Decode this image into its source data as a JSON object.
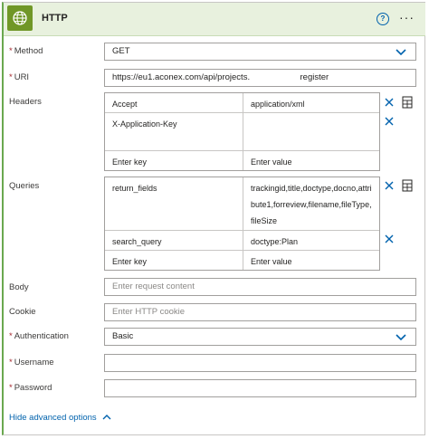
{
  "header": {
    "title": "HTTP",
    "help_glyph": "?",
    "more_glyph": "···"
  },
  "method": {
    "label": "Method",
    "value": "GET"
  },
  "uri": {
    "label": "URI",
    "value": "https://eu1.aconex.com/api/projects.                     register"
  },
  "headers": {
    "label": "Headers",
    "rows": [
      {
        "key": "Accept",
        "value": "application/xml"
      },
      {
        "key": "X-Application-Key",
        "value": ""
      }
    ],
    "key_placeholder": "Enter key",
    "value_placeholder": "Enter value"
  },
  "queries": {
    "label": "Queries",
    "rows": [
      {
        "key": "return_fields",
        "value": "trackingid,title,doctype,docno,attribute1,forreview,filename,fileType,fileSize"
      },
      {
        "key": "search_query",
        "value": "doctype:Plan"
      }
    ],
    "key_placeholder": "Enter key",
    "value_placeholder": "Enter value"
  },
  "body": {
    "label": "Body",
    "placeholder": "Enter request content"
  },
  "cookie": {
    "label": "Cookie",
    "placeholder": "Enter HTTP cookie"
  },
  "authentication": {
    "label": "Authentication",
    "value": "Basic"
  },
  "username": {
    "label": "Username",
    "value": ""
  },
  "password": {
    "label": "Password",
    "value": ""
  },
  "advanced": {
    "label": "Hide advanced options"
  },
  "colors": {
    "accent": "#0062ad",
    "header_bg": "#e8f1de",
    "icon_bg": "#709727",
    "required": "#a4262c"
  },
  "icons": [
    "globe-icon",
    "help-icon",
    "more-icon",
    "chevron-down-icon",
    "delete-icon",
    "switch-to-text-mode-icon",
    "chevron-up-icon"
  ]
}
